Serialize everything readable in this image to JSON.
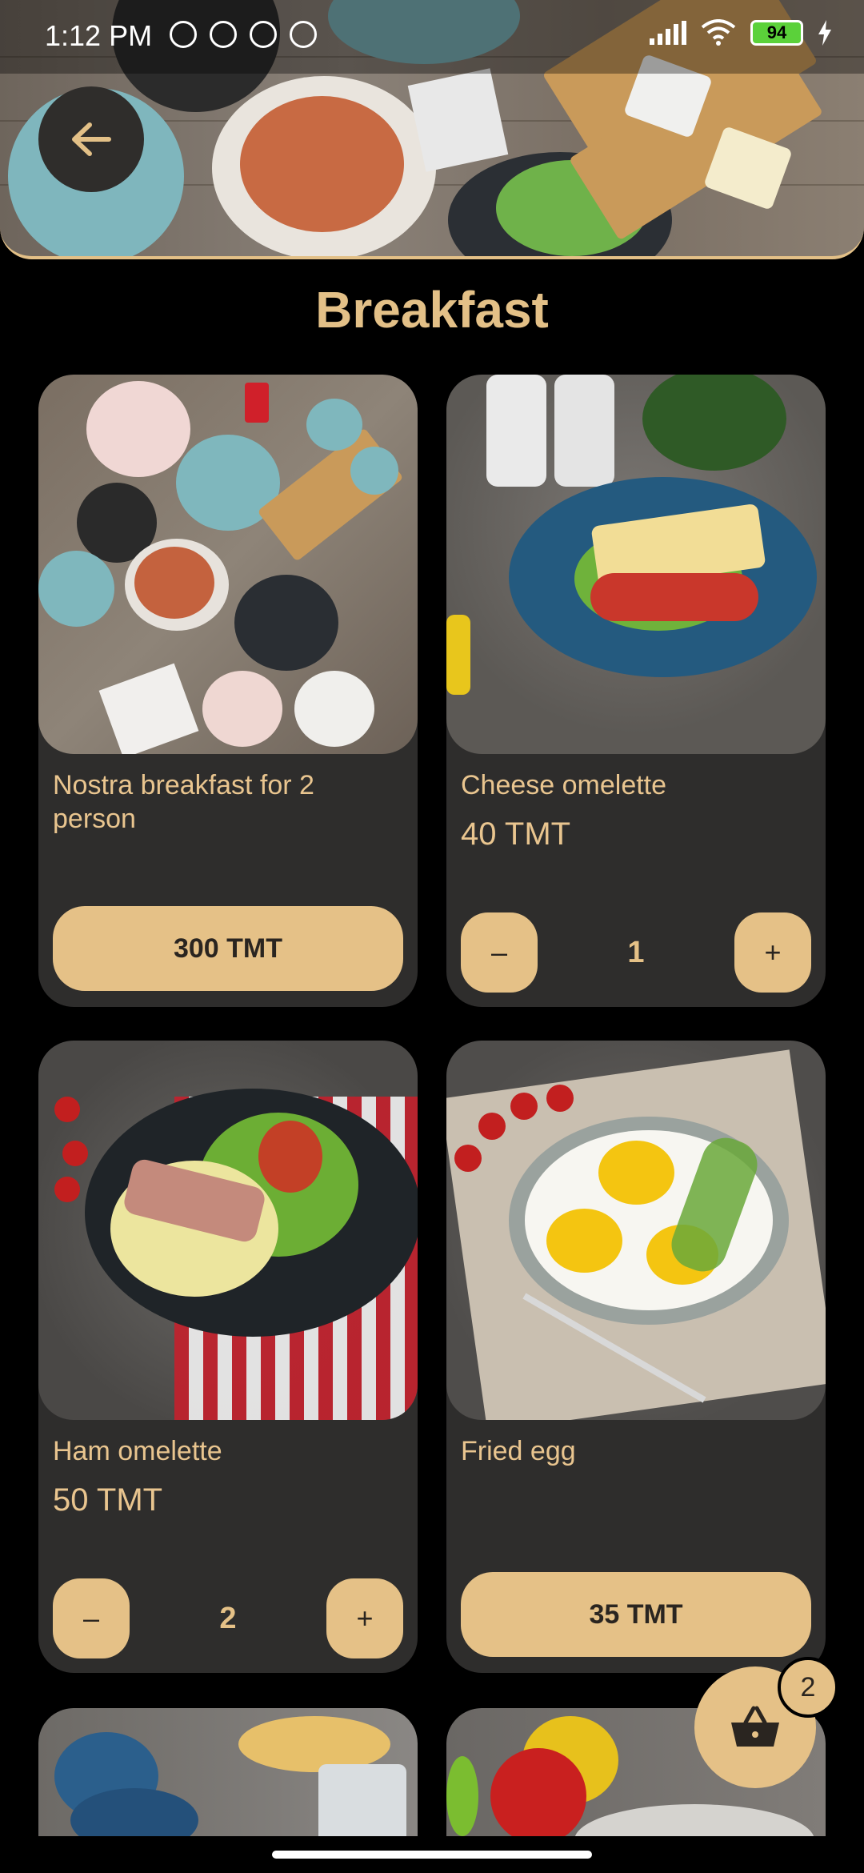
{
  "status_bar": {
    "time": "1:12 PM",
    "battery": "94",
    "icons": [
      "mute-icon",
      "alarm-icon",
      "app-icon",
      "app-icon",
      "signal-icon",
      "wifi-icon",
      "battery-icon",
      "charging-icon"
    ]
  },
  "header": {
    "back_icon": "arrow-left-icon"
  },
  "page_title": "Breakfast",
  "colors": {
    "accent": "#e5c187",
    "card_bg": "#2e2d2c",
    "background": "#000000"
  },
  "products": [
    {
      "name": "Nostra breakfast for 2 person",
      "price_button": "300 TMT"
    },
    {
      "name": "Cheese omelette",
      "price": "40 TMT",
      "quantity": "1",
      "minus": "–",
      "plus": "+"
    },
    {
      "name": "Ham omelette",
      "price": "50 TMT",
      "quantity": "2",
      "minus": "–",
      "plus": "+"
    },
    {
      "name": "Fried egg",
      "price_button": "35 TMT"
    }
  ],
  "cart": {
    "icon": "basket-icon",
    "count": "2"
  }
}
